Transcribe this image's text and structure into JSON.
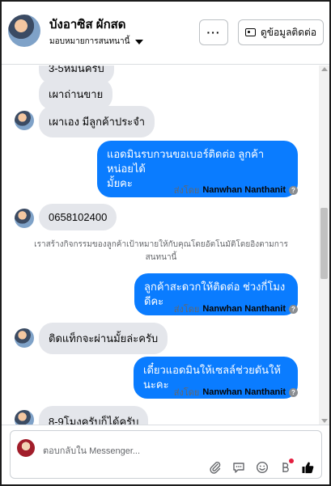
{
  "header": {
    "name": "บังอาซิส ผักสด",
    "sub": "มอบหมายการสนทนานี้",
    "more_label": "···",
    "contact_label": "ดูข้อมูลติดต่อ"
  },
  "messages": {
    "m1": "3-5หมื่นครับ",
    "m2": "เผาถ่านขาย",
    "m3": "เผาเอง มีลูกค้าประจำ",
    "m4_line1": "แอดมินรบกวนขอเบอร์ติดต่อ ลูกค้าหน่อยได้",
    "m4_line2": "มั้ยคะ",
    "m5": "0658102400",
    "notice_line1": "เราสร้างกิจกรรมของลูกค้าเป้าหมายให้กับคุณโดยอัตโนมัติโดยอิงตามการ",
    "notice_line2": "สนทนานี้",
    "m6": "ลูกค้าสะดวกให้ติดต่อ ช่วงกี่โมงดีคะ",
    "m7": "ติดแท็กจะผ่านมั้ยล่ะครับ",
    "m8": "เดี๋ยวแอดมินให้เซลล์ช่วยดันให้นะคะ",
    "m9": "8-9โมงครับก็ได้ครับ"
  },
  "sentby": {
    "prefix": "ส่งโดย",
    "name": "Nanwhan Nanthanit"
  },
  "composer": {
    "placeholder": "ตอบกลับใน Messenger..."
  },
  "colors": {
    "outgoing_bubble": "#0a7cff",
    "incoming_bubble": "#e4e6eb",
    "like_button": "#050505",
    "badge": "#e41e3f"
  },
  "icons": [
    "more-icon",
    "contact-card-icon",
    "attach-icon",
    "saved-reply-icon",
    "emoji-icon",
    "payment-icon",
    "like-icon",
    "info-icon"
  ]
}
